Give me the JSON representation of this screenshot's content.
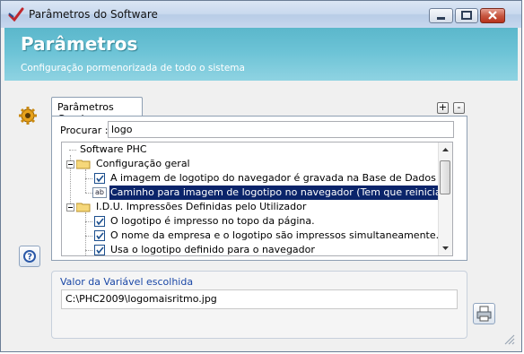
{
  "window": {
    "title": "Parâmetros do Software",
    "app_icon": "checkmark-logo-icon"
  },
  "banner": {
    "title": "Parâmetros",
    "subtitle": "Configuração pormenorizada de todo o sistema",
    "color": "#6cc3d6"
  },
  "tabs": [
    {
      "label": "Parâmetros Gerais",
      "selected": true
    }
  ],
  "toolbar": {
    "expand_label": "+",
    "collapse_label": "-"
  },
  "search": {
    "label": "Procurar :",
    "value": "logo"
  },
  "tree": {
    "root": "Software PHC",
    "items": [
      {
        "label": "Configuração geral",
        "kind": "folder",
        "level": 1
      },
      {
        "label": "A imagem de logotipo do navegador é gravada na Base de Dados (Tem que",
        "kind": "checkbox",
        "checked": true,
        "level": 2
      },
      {
        "label": "Caminho para imagem de logotipo no navegador (Tem que reiniciar a aplicação",
        "kind": "text-param",
        "selected": true,
        "level": 2
      },
      {
        "label": "I.D.U. Impressões Definidas pelo Utilizador",
        "kind": "folder",
        "level": 1
      },
      {
        "label": "O logotipo é impresso no topo da página.",
        "kind": "checkbox",
        "checked": true,
        "level": 2
      },
      {
        "label": "O nome da empresa e o logotipo são impressos simultaneamente.",
        "kind": "checkbox",
        "checked": true,
        "level": 2
      },
      {
        "label": "Usa o logotipo definido para o navegador",
        "kind": "checkbox",
        "checked": true,
        "level": 2
      }
    ]
  },
  "value_panel": {
    "label": "Valor da Variável escolhida",
    "value": "C:\\PHC2009\\logomaisritmo.jpg"
  },
  "colors": {
    "selection": "#0a246a",
    "accent_label": "#1a47a6"
  }
}
